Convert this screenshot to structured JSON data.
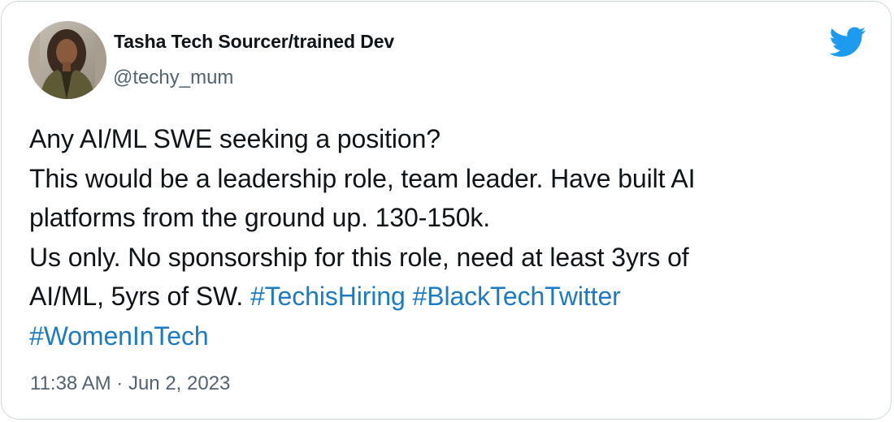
{
  "author": {
    "name": "Tasha Tech Sourcer/trained Dev",
    "handle": "@techy_mum",
    "avatar": "profile-photo"
  },
  "brand": {
    "icon": "twitter-bird-icon",
    "color": "#1d9bf0"
  },
  "tweet": {
    "line1": "Any AI/ML SWE seeking a position?",
    "line2": "This would be a leadership role, team leader. Have built AI",
    "line3": "platforms from the ground up. 130-150k.",
    "line4": "Us only. No sponsorship for this role, need at least 3yrs of",
    "line5_text": "AI/ML, 5yrs of SW. ",
    "hashtags": [
      "#TechisHiring",
      "#BlackTechTwitter",
      "#WomenInTech"
    ]
  },
  "meta": {
    "timestamp": "11:38 AM · Jun 2, 2023"
  },
  "colors": {
    "text": "#0f1419",
    "secondary": "#536471",
    "link": "#1b7bc4",
    "border": "#cfd9de"
  }
}
